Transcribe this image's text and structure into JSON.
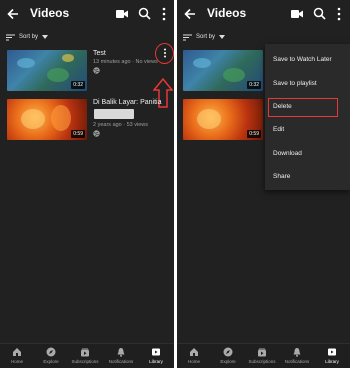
{
  "header": {
    "title": "Videos"
  },
  "sort": {
    "label": "Sort by"
  },
  "videos": [
    {
      "title": "Test",
      "meta": "13 minutes ago · No views",
      "duration": "0:32"
    },
    {
      "title": "Di Balik Layar: Panitia",
      "meta": "2 years ago · 53 views",
      "duration": "0:59"
    }
  ],
  "menu": {
    "items": [
      "Save to Watch Later",
      "Save to playlist",
      "Delete",
      "Edit",
      "Download",
      "Share"
    ],
    "highlighted": "Delete"
  },
  "bottom_nav": [
    "Home",
    "Explore",
    "Subscriptions",
    "Notifications",
    "Library"
  ],
  "active_nav": "Library",
  "colors": {
    "background": "#212121",
    "annotation": "#e53935",
    "text": "#ffffff",
    "meta": "#9e9e9e"
  }
}
